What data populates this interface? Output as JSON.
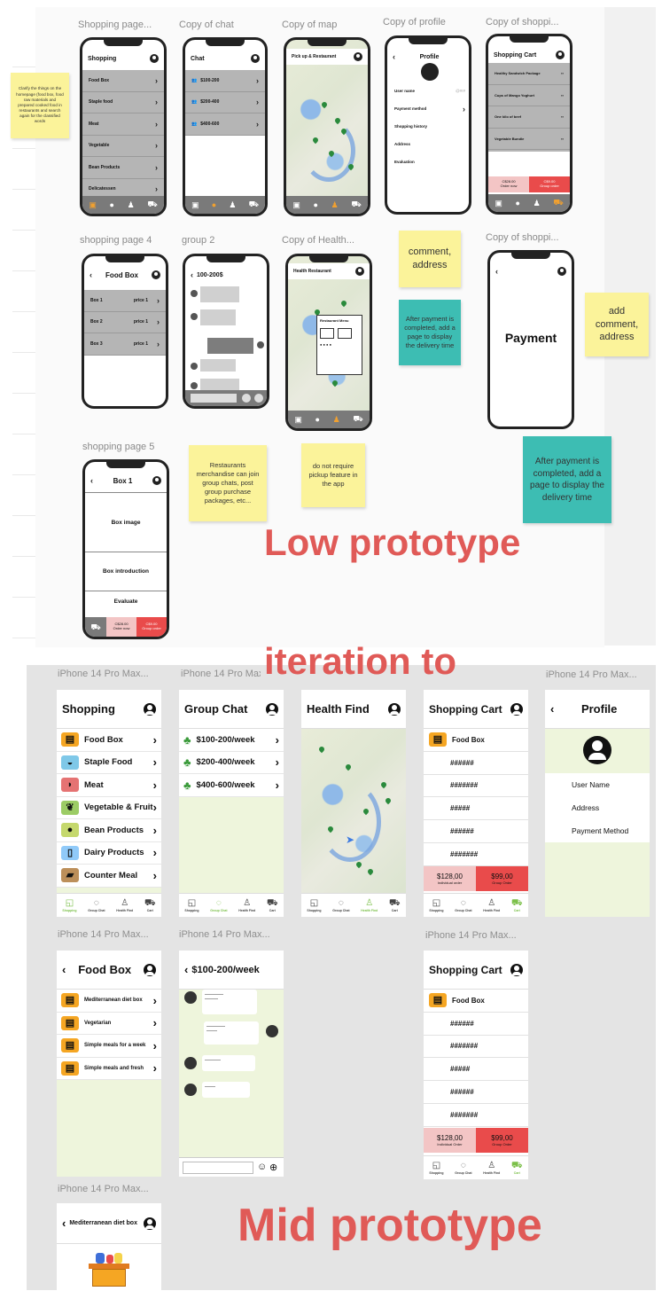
{
  "low_prototype": {
    "frame_labels": [
      "Shopping page...",
      "Copy of chat",
      "Copy of map",
      "Copy of profile",
      "Copy of shoppi...",
      "shopping page 4",
      "group 2",
      "Copy of Health...",
      "Copy of shoppi...",
      "shopping page 5"
    ],
    "shopping": {
      "title": "Shopping",
      "items": [
        "Food Box",
        "Staple food",
        "Meat",
        "Vegetable",
        "Bean Products",
        "Delicatessen"
      ]
    },
    "chat": {
      "title": "Chat",
      "items": [
        "$100-200",
        "$200-400",
        "$400-600"
      ]
    },
    "map": {
      "title": "Pick up & Restaurant"
    },
    "profile": {
      "title": "Profile",
      "rows": [
        "User name",
        "Payment method",
        "Shopping history",
        "Address",
        "Evaluation"
      ],
      "user_hint": "@#!#"
    },
    "cart": {
      "title": "Shopping Cart",
      "items": [
        "Healthy Sandwich Package",
        "Cups of Mango Yoghurt",
        "One kilo of beef",
        "Vegetable Bundle"
      ],
      "individual_price": "C$28.00",
      "individual_label": "Order now",
      "group_price": "C$9.00",
      "group_label": "Group order"
    },
    "food_box": {
      "title": "Food Box",
      "rows": [
        {
          "name": "Box 1",
          "price": "price 1"
        },
        {
          "name": "Box 2",
          "price": "price 1"
        },
        {
          "name": "Box 3",
          "price": "price 1"
        }
      ]
    },
    "group2": {
      "title": "100-200$"
    },
    "health": {
      "title": "Health Restaurant",
      "popup_title": "Restaurant Menu"
    },
    "payment": {
      "title": "Payment"
    },
    "box1": {
      "title": "Box 1",
      "sections": [
        "Box image",
        "Box introduction",
        "Evaluate"
      ],
      "individual_price": "C$28.00",
      "individual_label": "Order now",
      "group_price": "C$9.00",
      "group_label": "Group order"
    },
    "notes": {
      "clarify": "Clarify the things on the homepage (food box, food raw materials and prepared cooked food in restaurants and search again for the classified words",
      "comment1": "comment, address",
      "after1": "After payment is completed, add a page to display the delivery time",
      "comment2": "add comment, address",
      "restaurants": "Restaurants merchandise can join group chats, post group purchase packages, etc...",
      "pickup": "do not require pickup feature in the app",
      "after2": "After payment is completed, add a page to display the delivery time"
    }
  },
  "headline": {
    "low": "Low prototype",
    "iteration": "iteration to",
    "mid": "Mid prototype"
  },
  "mid_prototype": {
    "frame_label": "iPhone 14 Pro Max...",
    "shopping": {
      "title": "Shopping",
      "items": [
        "Food Box",
        "Staple Food",
        "Meat",
        "Vegetable & Fruit",
        "Bean Products",
        "Dairy Products",
        "Counter Meal"
      ]
    },
    "group_chat": {
      "title": "Group Chat",
      "items": [
        "$100-200/week",
        "$200-400/week",
        "$400-600/week"
      ]
    },
    "health_find": {
      "title": "Health Find"
    },
    "cart": {
      "title": "Shopping Cart",
      "first": "Food Box",
      "rows": [
        "######",
        "#######",
        "#####",
        "######",
        "#######"
      ],
      "individual_price": "$128,00",
      "individual_label": "Individual order",
      "group_price": "$99,00",
      "group_label": "Group Order"
    },
    "profile": {
      "title": "Profile",
      "rows": [
        "User Name",
        "Address",
        "Payment Method"
      ]
    },
    "food_box": {
      "title": "Food Box",
      "items": [
        "Mediterranean diet box",
        "Vegetarian",
        "Simple meals for a week",
        "Simple meals and fresh"
      ]
    },
    "chat_room": {
      "title": "$100-200/week"
    },
    "cart2": {
      "title": "Shopping Cart",
      "first": "Food Box",
      "rows": [
        "######",
        "#######",
        "#####",
        "######",
        "#######"
      ],
      "individual_price": "$128,00",
      "individual_label": "Individual Order",
      "group_price": "$99,00",
      "group_label": "Group Order"
    },
    "diet_box": {
      "title": "Mediterranean diet box"
    },
    "tabs": [
      "Shopping",
      "Group Chat",
      "Health Find",
      "Cart"
    ]
  },
  "colors": {
    "headline": "#e05a57",
    "sticky_yellow": "#fbf39a",
    "sticky_teal": "#3dbdb3",
    "mid_body": "#eef5dc",
    "group_order": "#e94b4b",
    "individual_order": "#f3c5c5",
    "accent_green": "#7cc04a"
  }
}
